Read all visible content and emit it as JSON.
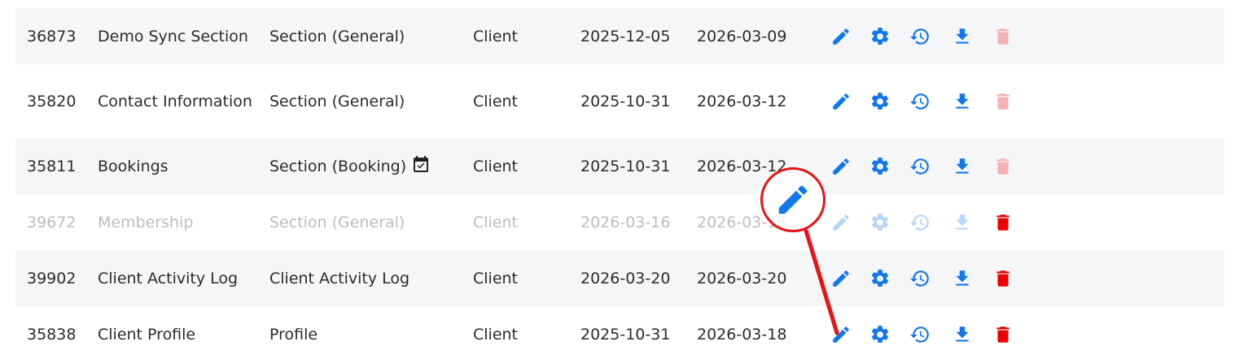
{
  "rows": [
    {
      "id": "36873",
      "name": "Demo Sync Section",
      "type": "Section (General)",
      "owner": "Client",
      "created": "2025-12-05",
      "updated": "2026-03-09",
      "delete_state": "disabled"
    },
    {
      "id": "35820",
      "name": "Contact Information",
      "type": "Section (General)",
      "owner": "Client",
      "created": "2025-10-31",
      "updated": "2026-03-12",
      "delete_state": "disabled"
    },
    {
      "id": "35811",
      "name": "Bookings",
      "type": "Section (Booking)",
      "type_icon": "calendar-check-icon",
      "owner": "Client",
      "created": "2025-10-31",
      "updated": "2026-03-12",
      "delete_state": "disabled"
    },
    {
      "id": "39672",
      "name": "Membership",
      "type": "Section (General)",
      "owner": "Client",
      "created": "2026-03-16",
      "updated": "2026-03-16",
      "row_state": "inactive",
      "delete_state": "enabled"
    },
    {
      "id": "39902",
      "name": "Client Activity Log",
      "type": "Client Activity Log",
      "owner": "Client",
      "created": "2026-03-20",
      "updated": "2026-03-20",
      "delete_state": "enabled"
    },
    {
      "id": "35838",
      "name": "Client Profile",
      "type": "Profile",
      "owner": "Client",
      "created": "2025-10-31",
      "updated": "2026-03-18",
      "delete_state": "enabled"
    }
  ],
  "row_actions": [
    "pencil-icon",
    "gear-icon",
    "history-icon",
    "download-icon",
    "trash-icon"
  ],
  "annotation": {
    "icon": "pencil-icon",
    "color": "#ee1111",
    "target": "edit action of row 35838"
  },
  "colors": {
    "action": "#1177ee",
    "action_dim": "#b7d6fa",
    "delete": "#ee0000",
    "delete_disabled": "#f5b0b0",
    "row_alt": "#f5f6f8"
  }
}
